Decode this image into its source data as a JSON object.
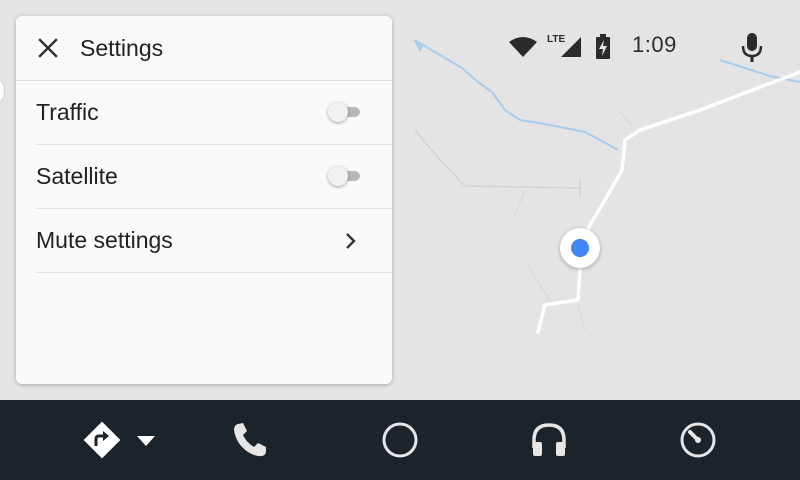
{
  "status_bar": {
    "time": "1:09",
    "network_label": "LTE",
    "icons": [
      "wifi-icon",
      "cell-signal-icon",
      "battery-charging-icon",
      "microphone-icon"
    ]
  },
  "settings_panel": {
    "title": "Settings",
    "close_icon": "close-icon",
    "rows": [
      {
        "label": "Traffic",
        "control": "toggle",
        "on": false
      },
      {
        "label": "Satellite",
        "control": "toggle",
        "on": false
      },
      {
        "label": "Mute settings",
        "control": "chevron-right-icon"
      }
    ]
  },
  "nav_bar": {
    "items": [
      {
        "icon": "navigation-icon",
        "has_dropdown": true
      },
      {
        "icon": "phone-icon"
      },
      {
        "icon": "home-circle-icon"
      },
      {
        "icon": "headphones-icon"
      },
      {
        "icon": "speedometer-icon"
      }
    ]
  },
  "colors": {
    "map_background": "#e4e4e4",
    "panel_background": "#fafafa",
    "nav_bar_background": "#1b232b",
    "location_dot": "#4285f4",
    "water": "#a8cdef",
    "road": "#ffffff",
    "icon_dark": "#2b2b2b",
    "icon_light": "#e6e6e6"
  }
}
